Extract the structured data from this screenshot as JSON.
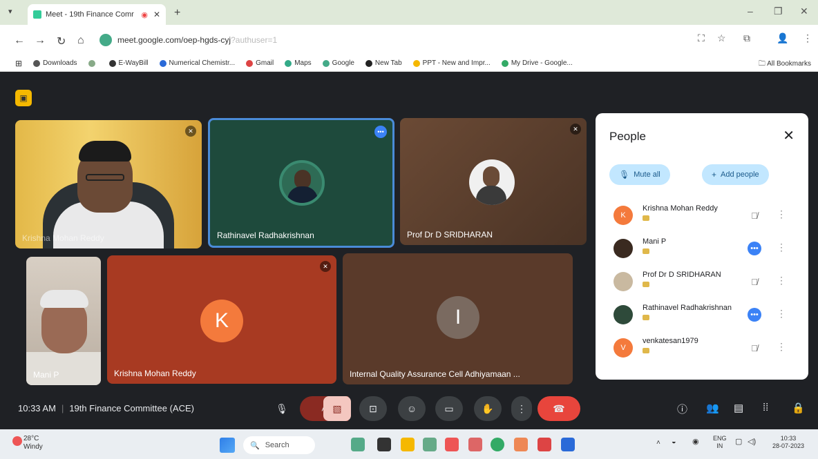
{
  "browser": {
    "tab_title": "Meet - 19th Finance Comr",
    "url_main": "meet.google.com/oep-hgds-cyj",
    "url_faded": "?authuser=1",
    "bookmarks": [
      "Downloads",
      "E-WayBill",
      "Numerical Chemistr...",
      "Gmail",
      "Maps",
      "Google",
      "New Tab",
      "PPT - New and Impr...",
      "My Drive - Google..."
    ],
    "all_bookmarks": "All Bookmarks"
  },
  "tiles": {
    "t1_label": "Krishna Mohan Reddy",
    "t2_label": "Rathinavel Radhakrishnan",
    "t3_label": "Prof Dr D SRIDHARAN",
    "t4_label": "Mani P",
    "t5_label": "Krishna Mohan Reddy",
    "t5_initial": "K",
    "t6_label": "Internal Quality Assurance Cell Adhiyamaan ...",
    "t6_initial": "I"
  },
  "people_panel": {
    "title": "People",
    "mute_all": "Mute all",
    "add_people": "Add people",
    "participants": [
      {
        "name": "Krishna Mohan Reddy",
        "color": "#f47a3c",
        "initial": "K"
      },
      {
        "name": "Mani P",
        "color": "#3a2a20",
        "initial": ""
      },
      {
        "name": "Prof Dr D SRIDHARAN",
        "color": "#c9b9a0",
        "initial": ""
      },
      {
        "name": "Rathinavel Radhakrishnan",
        "color": "#2e4a3a",
        "initial": ""
      },
      {
        "name": "venkatesan1979",
        "color": "#f47a3c",
        "initial": "V"
      }
    ]
  },
  "meeting": {
    "time": "10:33 AM",
    "name": "19th Finance Committee (ACE)"
  },
  "taskbar": {
    "temp": "28°C",
    "weather": "Windy",
    "search": "Search",
    "lang": "ENG",
    "region": "IN",
    "clock_time": "10:33",
    "clock_date": "28-07-2023"
  }
}
